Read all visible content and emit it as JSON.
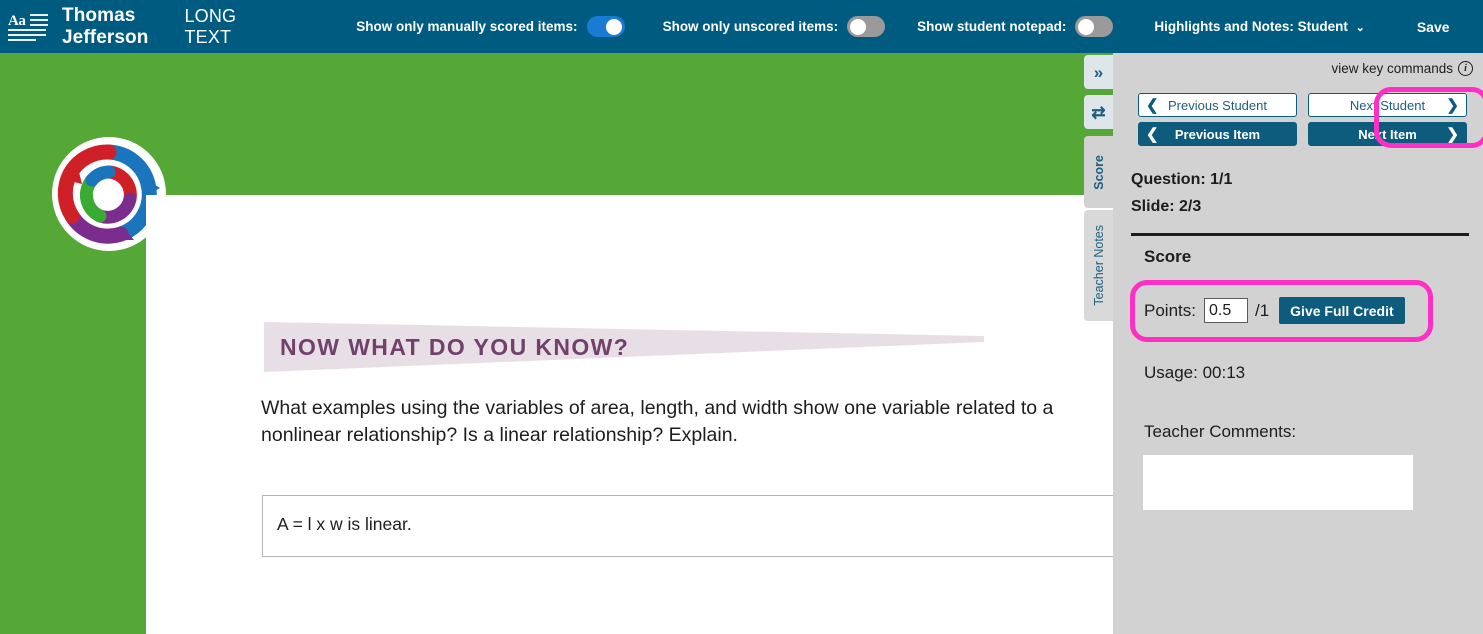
{
  "header": {
    "format_icon": "text-format-icon",
    "student_name": "Thomas Jefferson",
    "item_type": "LONG TEXT",
    "toggles": [
      {
        "label": "Show only manually scored items:",
        "state": "on"
      },
      {
        "label": "Show only unscored items:",
        "state": "off"
      },
      {
        "label": "Show student notepad:",
        "state": "off"
      }
    ],
    "highlights_notes": "Highlights and Notes: Student",
    "highlights_caret": "⌄",
    "save_label": "Save",
    "close_icon": "close-icon"
  },
  "stage": {
    "logo_name": "school-swirl-logo",
    "slide": {
      "title": "NOW WHAT DO YOU KNOW?",
      "question_line1": "What examples using the variables of area, length, and width show one variable related to a",
      "question_line2": "nonlinear relationship? Is a linear relationship? Explain.",
      "answer": "A = l x w is linear."
    }
  },
  "tabs": [
    {
      "name": "collapse-panel-tab",
      "glyph": "»",
      "label": ""
    },
    {
      "name": "swap-view-tab",
      "glyph": "⇄",
      "label": ""
    },
    {
      "name": "score-tab",
      "glyph": "",
      "label": "Score"
    },
    {
      "name": "teacher-notes-tab",
      "glyph": "",
      "label": "Teacher Notes"
    }
  ],
  "panel": {
    "view_key_commands": "view key commands",
    "info_glyph": "i",
    "nav": {
      "previous_student": "Previous Student",
      "next_student": "Next Student",
      "previous_item": "Previous Item",
      "next_item": "Next Item",
      "left_arrow": "❮",
      "right_arrow": "❯"
    },
    "question_counter": "Question: 1/1",
    "slide_counter": "Slide: 2/3",
    "score_heading": "Score",
    "points_label": "Points:",
    "points_value": "0.5",
    "points_max": "/1",
    "give_full_credit": "Give Full Credit",
    "usage": "Usage: 00:13",
    "teacher_comments_label": "Teacher Comments:",
    "teacher_comments_value": "",
    "teacher_comments_placeholder": ""
  },
  "colors": {
    "header_teal": "#005b80",
    "stage_green": "#55a736",
    "panel_gray": "#d2d2d2",
    "accent_teal": "#0d5c7d",
    "highlight_pink": "#ff2ec4",
    "toggle_on_blue": "#1a7bd4",
    "title_purple": "#70416b"
  }
}
